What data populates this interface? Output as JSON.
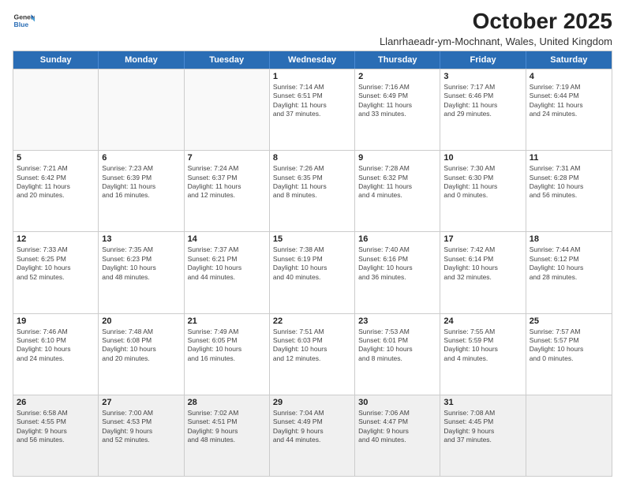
{
  "logo": {
    "general": "General",
    "blue": "Blue"
  },
  "title": {
    "month_year": "October 2025",
    "location": "Llanrhaeadr-ym-Mochnant, Wales, United Kingdom"
  },
  "calendar": {
    "headers": [
      "Sunday",
      "Monday",
      "Tuesday",
      "Wednesday",
      "Thursday",
      "Friday",
      "Saturday"
    ],
    "rows": [
      [
        {
          "day": "",
          "info": ""
        },
        {
          "day": "",
          "info": ""
        },
        {
          "day": "",
          "info": ""
        },
        {
          "day": "1",
          "info": "Sunrise: 7:14 AM\nSunset: 6:51 PM\nDaylight: 11 hours\nand 37 minutes."
        },
        {
          "day": "2",
          "info": "Sunrise: 7:16 AM\nSunset: 6:49 PM\nDaylight: 11 hours\nand 33 minutes."
        },
        {
          "day": "3",
          "info": "Sunrise: 7:17 AM\nSunset: 6:46 PM\nDaylight: 11 hours\nand 29 minutes."
        },
        {
          "day": "4",
          "info": "Sunrise: 7:19 AM\nSunset: 6:44 PM\nDaylight: 11 hours\nand 24 minutes."
        }
      ],
      [
        {
          "day": "5",
          "info": "Sunrise: 7:21 AM\nSunset: 6:42 PM\nDaylight: 11 hours\nand 20 minutes."
        },
        {
          "day": "6",
          "info": "Sunrise: 7:23 AM\nSunset: 6:39 PM\nDaylight: 11 hours\nand 16 minutes."
        },
        {
          "day": "7",
          "info": "Sunrise: 7:24 AM\nSunset: 6:37 PM\nDaylight: 11 hours\nand 12 minutes."
        },
        {
          "day": "8",
          "info": "Sunrise: 7:26 AM\nSunset: 6:35 PM\nDaylight: 11 hours\nand 8 minutes."
        },
        {
          "day": "9",
          "info": "Sunrise: 7:28 AM\nSunset: 6:32 PM\nDaylight: 11 hours\nand 4 minutes."
        },
        {
          "day": "10",
          "info": "Sunrise: 7:30 AM\nSunset: 6:30 PM\nDaylight: 11 hours\nand 0 minutes."
        },
        {
          "day": "11",
          "info": "Sunrise: 7:31 AM\nSunset: 6:28 PM\nDaylight: 10 hours\nand 56 minutes."
        }
      ],
      [
        {
          "day": "12",
          "info": "Sunrise: 7:33 AM\nSunset: 6:25 PM\nDaylight: 10 hours\nand 52 minutes."
        },
        {
          "day": "13",
          "info": "Sunrise: 7:35 AM\nSunset: 6:23 PM\nDaylight: 10 hours\nand 48 minutes."
        },
        {
          "day": "14",
          "info": "Sunrise: 7:37 AM\nSunset: 6:21 PM\nDaylight: 10 hours\nand 44 minutes."
        },
        {
          "day": "15",
          "info": "Sunrise: 7:38 AM\nSunset: 6:19 PM\nDaylight: 10 hours\nand 40 minutes."
        },
        {
          "day": "16",
          "info": "Sunrise: 7:40 AM\nSunset: 6:16 PM\nDaylight: 10 hours\nand 36 minutes."
        },
        {
          "day": "17",
          "info": "Sunrise: 7:42 AM\nSunset: 6:14 PM\nDaylight: 10 hours\nand 32 minutes."
        },
        {
          "day": "18",
          "info": "Sunrise: 7:44 AM\nSunset: 6:12 PM\nDaylight: 10 hours\nand 28 minutes."
        }
      ],
      [
        {
          "day": "19",
          "info": "Sunrise: 7:46 AM\nSunset: 6:10 PM\nDaylight: 10 hours\nand 24 minutes."
        },
        {
          "day": "20",
          "info": "Sunrise: 7:48 AM\nSunset: 6:08 PM\nDaylight: 10 hours\nand 20 minutes."
        },
        {
          "day": "21",
          "info": "Sunrise: 7:49 AM\nSunset: 6:05 PM\nDaylight: 10 hours\nand 16 minutes."
        },
        {
          "day": "22",
          "info": "Sunrise: 7:51 AM\nSunset: 6:03 PM\nDaylight: 10 hours\nand 12 minutes."
        },
        {
          "day": "23",
          "info": "Sunrise: 7:53 AM\nSunset: 6:01 PM\nDaylight: 10 hours\nand 8 minutes."
        },
        {
          "day": "24",
          "info": "Sunrise: 7:55 AM\nSunset: 5:59 PM\nDaylight: 10 hours\nand 4 minutes."
        },
        {
          "day": "25",
          "info": "Sunrise: 7:57 AM\nSunset: 5:57 PM\nDaylight: 10 hours\nand 0 minutes."
        }
      ],
      [
        {
          "day": "26",
          "info": "Sunrise: 6:58 AM\nSunset: 4:55 PM\nDaylight: 9 hours\nand 56 minutes."
        },
        {
          "day": "27",
          "info": "Sunrise: 7:00 AM\nSunset: 4:53 PM\nDaylight: 9 hours\nand 52 minutes."
        },
        {
          "day": "28",
          "info": "Sunrise: 7:02 AM\nSunset: 4:51 PM\nDaylight: 9 hours\nand 48 minutes."
        },
        {
          "day": "29",
          "info": "Sunrise: 7:04 AM\nSunset: 4:49 PM\nDaylight: 9 hours\nand 44 minutes."
        },
        {
          "day": "30",
          "info": "Sunrise: 7:06 AM\nSunset: 4:47 PM\nDaylight: 9 hours\nand 40 minutes."
        },
        {
          "day": "31",
          "info": "Sunrise: 7:08 AM\nSunset: 4:45 PM\nDaylight: 9 hours\nand 37 minutes."
        },
        {
          "day": "",
          "info": ""
        }
      ]
    ]
  }
}
